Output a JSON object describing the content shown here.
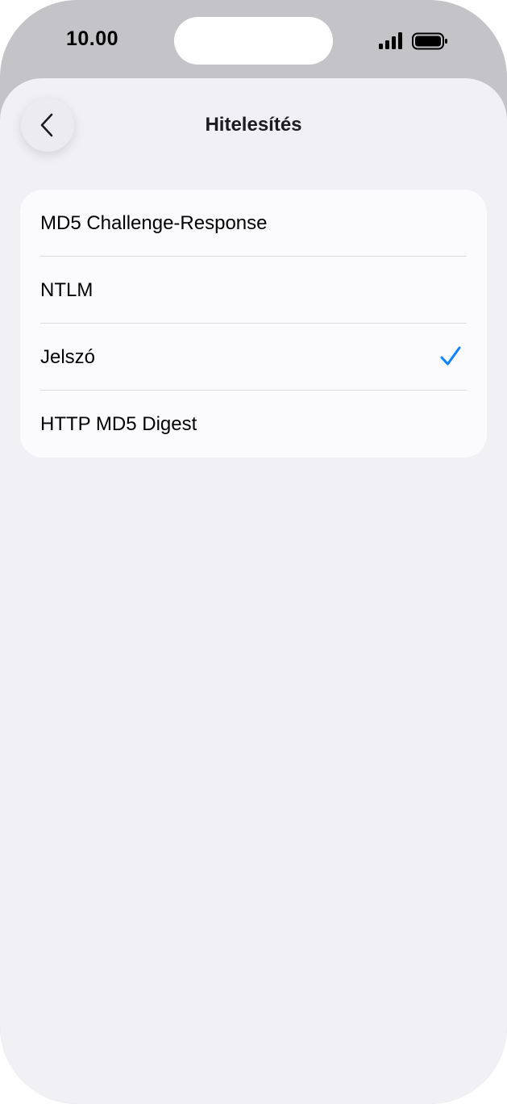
{
  "status_bar": {
    "time": "10.00",
    "icons": [
      "signal-icon",
      "battery-icon"
    ]
  },
  "nav": {
    "back_icon": "chevron-left-icon",
    "title": "Hitelesítés"
  },
  "options": [
    {
      "label": "MD5 Challenge-Response",
      "selected": false
    },
    {
      "label": "NTLM",
      "selected": false
    },
    {
      "label": "Jelszó",
      "selected": true
    },
    {
      "label": "HTTP MD5 Digest",
      "selected": false
    }
  ],
  "colors": {
    "accent": "#0a84ff",
    "background": "#f0f0f5",
    "card": "#fbfbfd",
    "bezel": "#c3c3c8"
  }
}
